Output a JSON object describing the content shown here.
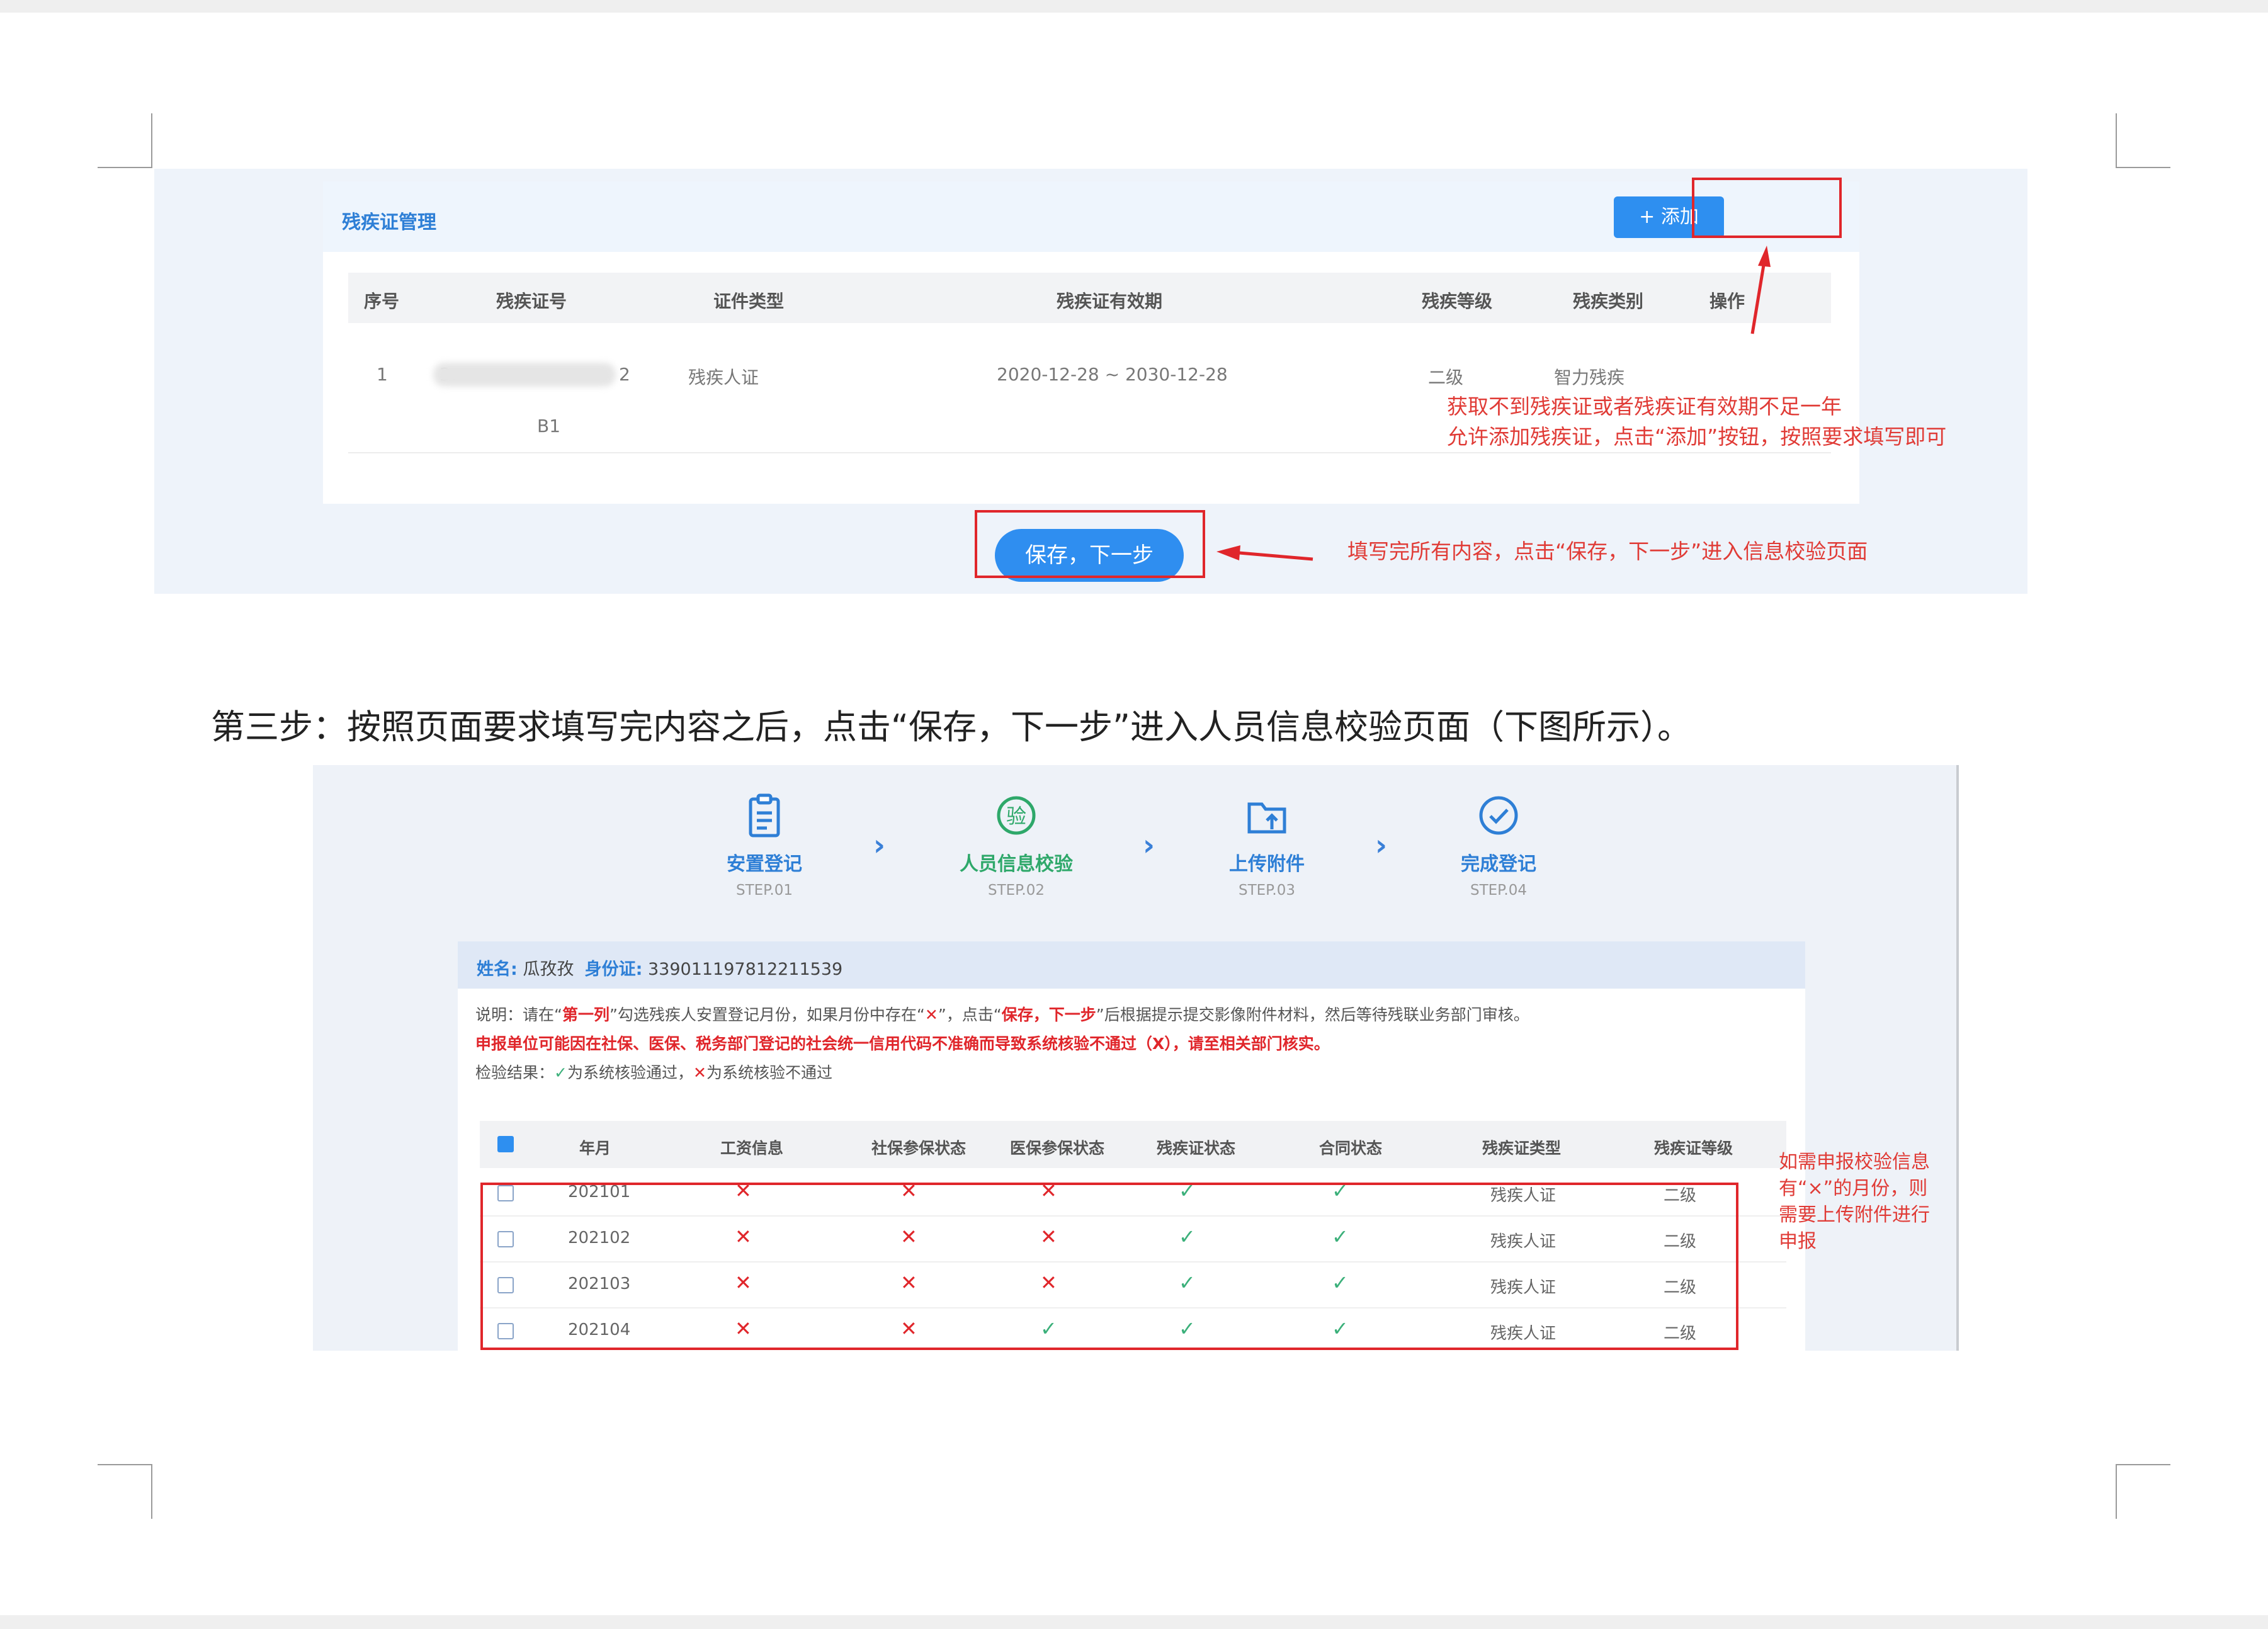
{
  "screenshot1": {
    "panel_title": "残疾证管理",
    "add_button": "+ 添加",
    "columns": [
      "序号",
      "残疾证号",
      "证件类型",
      "残疾证有效期",
      "残疾等级",
      "残疾类别",
      "操作"
    ],
    "row": {
      "index": "1",
      "cert_no_start": "3:",
      "cert_no_end": "2",
      "cert_no_line2": "B1",
      "cert_type": "残疾人证",
      "validity": "2020-12-28 ~ 2030-12-28",
      "grade": "二级",
      "category": "智力残疾"
    },
    "save_button": "保存，下一步",
    "note_add_line1": "获取不到残疾证或者残疾证有效期不足一年",
    "note_add_line2": "允许添加残疾证，点击“添加”按钮，按照要求填写即可",
    "note_save": "填写完所有内容，点击“保存，下一步”进入信息校验页面"
  },
  "step_text": "第三步：按照页面要求填写完内容之后，点击“保存，下一步”进入人员信息校验页面（下图所示）。",
  "screenshot2": {
    "steps": [
      {
        "label": "安置登记",
        "sub": "STEP.01",
        "color": "#2e7fd6",
        "icon": "clipboard-icon"
      },
      {
        "label": "人员信息校验",
        "sub": "STEP.02",
        "color": "#2ea86a",
        "icon": "verify-icon"
      },
      {
        "label": "上传附件",
        "sub": "STEP.03",
        "color": "#2e7fd6",
        "icon": "upload-folder-icon"
      },
      {
        "label": "完成登记",
        "sub": "STEP.04",
        "color": "#2e7fd6",
        "icon": "check-circle-icon"
      }
    ],
    "chevron": "›",
    "name_label": "姓名:",
    "name_value": "瓜孜孜",
    "id_label": "身份证:",
    "id_value": "339011197812211539",
    "desc1_a": "说明：请在“",
    "desc1_b": "第一列",
    "desc1_c": "”勾选残疾人安置登记月份，如果月份中存在“",
    "desc1_x": "✕",
    "desc1_d": "”，点击“",
    "desc1_e": "保存，下一步",
    "desc1_f": "”后根据提示提交影像附件材料，然后等待残联业务部门审核。",
    "desc2": "申报单位可能因在社保、医保、税务部门登记的社会统一信用代码不准确而导致系统核验不通过（X），请至相关部门核实。",
    "desc3_a": "检验结果：",
    "desc3_check": "✓",
    "desc3_b": "为系统核验通过，",
    "desc3_x": "✕",
    "desc3_c": "为系统核验不通过",
    "columns": [
      "年月",
      "工资信息",
      "社保参保状态",
      "医保参保状态",
      "残疾证状态",
      "合同状态",
      "残疾证类型",
      "残疾证等级"
    ],
    "rows": [
      {
        "month": "202101",
        "wage": "✕",
        "social": "✕",
        "medical": "✕",
        "cert": "✓",
        "contract": "✓",
        "type": "残疾人证",
        "grade": "二级"
      },
      {
        "month": "202102",
        "wage": "✕",
        "social": "✕",
        "medical": "✕",
        "cert": "✓",
        "contract": "✓",
        "type": "残疾人证",
        "grade": "二级"
      },
      {
        "month": "202103",
        "wage": "✕",
        "social": "✕",
        "medical": "✕",
        "cert": "✓",
        "contract": "✓",
        "type": "残疾人证",
        "grade": "二级"
      },
      {
        "month": "202104",
        "wage": "✕",
        "social": "✕",
        "medical": "✓",
        "cert": "✓",
        "contract": "✓",
        "type": "残疾人证",
        "grade": "二级"
      }
    ],
    "note_lines": [
      "如需申报校验信息",
      "有“×”的月份，则",
      "需要上传附件进行",
      "申报"
    ]
  }
}
